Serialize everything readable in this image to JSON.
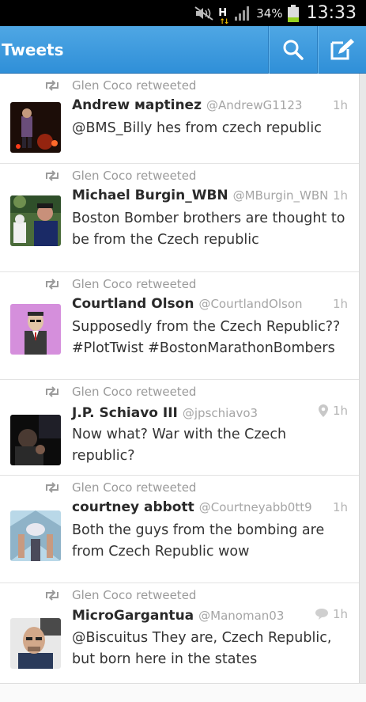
{
  "status_bar": {
    "battery_percent": "34%",
    "battery_level": 0.34,
    "time": "13:33",
    "network_type": "H",
    "icons": [
      "mute-icon",
      "hspa-icon",
      "signal-icon",
      "battery-icon"
    ]
  },
  "action_bar": {
    "title": "Tweets",
    "search_icon": "search-icon",
    "compose_icon": "compose-icon"
  },
  "colors": {
    "action_bar": "#3c9ae0",
    "status_bar": "#000000",
    "battery": "#96d020"
  },
  "tweets": [
    {
      "retweeted_by": "Glen Coco retweeted",
      "name": "Andrew марtinez",
      "handle": "@AndrewG1123",
      "time": "1h",
      "text": "@BMS_Billy hes from czech republic"
    },
    {
      "retweeted_by": "Glen Coco retweeted",
      "name": "Michael Burgin_WBN",
      "handle": "@MBurgin_WBN",
      "time": "1h",
      "text": "Boston Bomber brothers are thought to be from the Czech republic"
    },
    {
      "retweeted_by": "Glen Coco retweeted",
      "name": "Courtland Olson",
      "handle": "@CourtlandOlson",
      "time": "1h",
      "text": "Supposedly from the Czech Republic?? #PlotTwist #BostonMarathonBombers"
    },
    {
      "retweeted_by": "Glen Coco retweeted",
      "name": "J.P. Schiavo III",
      "handle": "@jpschiavo3",
      "time": "1h",
      "meta_icon": "location-pin-icon",
      "text": "Now what? War with the Czech republic?"
    },
    {
      "retweeted_by": "Glen Coco retweeted",
      "name": "courtney abbott",
      "handle": "@Courtneyabb0tt9",
      "time": "1h",
      "text": "Both the guys from the bombing are from Czech Republic wow"
    },
    {
      "retweeted_by": "Glen Coco retweeted",
      "name": "MicroGargantua",
      "handle": "@Manoman03",
      "time": "1h",
      "meta_icon": "conversation-icon",
      "text": "@Biscuitus They are, Czech Republic, but born here in the states"
    }
  ]
}
